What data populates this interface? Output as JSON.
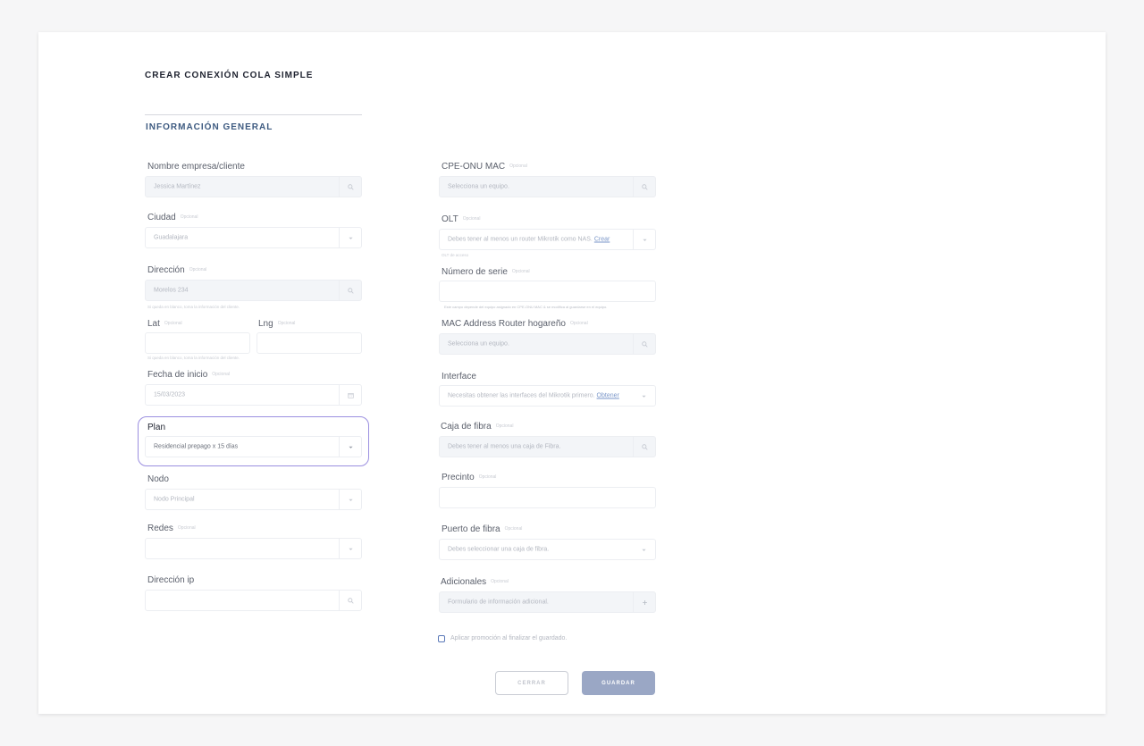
{
  "form": {
    "title": "CREAR CONEXIÓN COLA SIMPLE",
    "section_title": "INFORMACIÓN GENERAL",
    "optional_tag": "Opcional"
  },
  "left": {
    "client": {
      "label": "Nombre empresa/cliente",
      "value": "Jessica Martínez",
      "icon": "search-icon"
    },
    "city": {
      "label": "Ciudad",
      "value": "Guadalajara",
      "icon": "chevron-down-icon"
    },
    "address": {
      "label": "Dirección",
      "value": "Morelos 234",
      "hint": "Si queda en blanco, toma la información del cliente.",
      "icon": "search-icon"
    },
    "lat": {
      "label": "Lat",
      "value": ""
    },
    "lng": {
      "label": "Lng",
      "value": ""
    },
    "latlng_hint": "Si queda en blanco, toma la información del cliente.",
    "start_date": {
      "label": "Fecha de inicio",
      "value": "15/03/2023",
      "icon": "calendar-icon"
    },
    "plan": {
      "label": "Plan",
      "value": "Residencial prepago x 15 días",
      "icon": "chevron-down-icon"
    },
    "node": {
      "label": "Nodo",
      "value": "Nodo Principal",
      "icon": "chevron-down-icon"
    },
    "networks": {
      "label": "Redes",
      "value": "",
      "icon": "chevron-down-icon"
    },
    "ip": {
      "label": "Dirección ip",
      "value": "",
      "icon": "search-icon"
    }
  },
  "right": {
    "cpe": {
      "label": "CPE-ONU MAC",
      "placeholder": "Selecciona un equipo.",
      "icon": "search-icon"
    },
    "olt": {
      "label": "OLT",
      "placeholder": "Debes tener al menos un router Mikrotik como NAS.",
      "link": "Crear",
      "hint": "OLT de acceso",
      "icon": "chevron-down-icon"
    },
    "serial": {
      "label": "Número de serie",
      "value": "",
      "hint": "Este campo depende del equipo asignado en CPE-ONU MAC & se modifica al guardarse en el equipo."
    },
    "router_mac": {
      "label": "MAC Address Router hogareño",
      "placeholder": "Selecciona un equipo.",
      "icon": "search-icon"
    },
    "interface": {
      "label": "Interface",
      "placeholder": "Necesitas obtener las interfaces del Mikrotik primero.",
      "link": "Obtener",
      "icon": "chevron-down-icon"
    },
    "fiber_box": {
      "label": "Caja de fibra",
      "placeholder": "Debes tener al menos una caja de Fibra.",
      "icon": "search-icon"
    },
    "seal": {
      "label": "Precinto",
      "value": ""
    },
    "fiber_port": {
      "label": "Puerto de fibra",
      "placeholder": "Debes seleccionar una caja de fibra.",
      "icon": "chevron-down-icon"
    },
    "additional": {
      "label": "Adicionales",
      "placeholder": "Formulario de información adicional.",
      "icon": "plus-icon"
    }
  },
  "promo": {
    "label": "Aplicar promoción al finalizar el guardado.",
    "checked": false
  },
  "actions": {
    "close_label": "CERRAR",
    "save_label": "GUARDAR"
  },
  "colors": {
    "accent": "#3d5a80",
    "focus_ring": "#9b8fe0",
    "save_button": "#9aa7c5"
  }
}
